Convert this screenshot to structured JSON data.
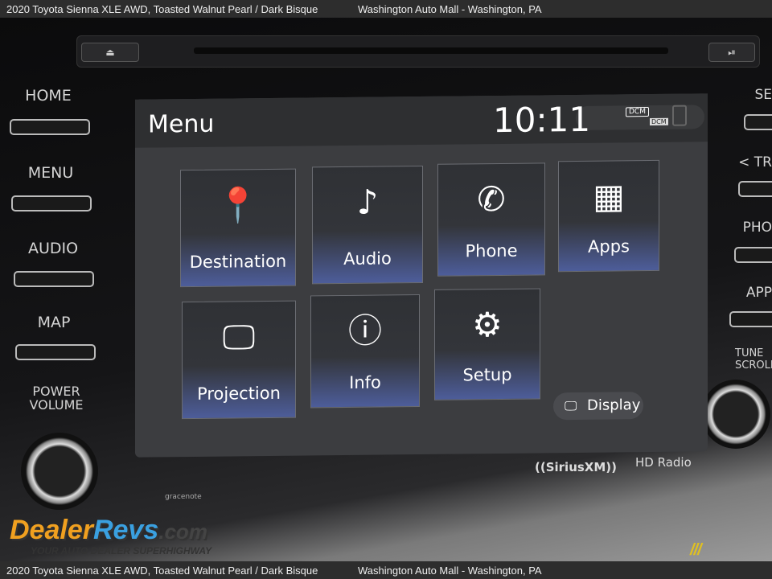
{
  "caption": {
    "vehicle": "2020 Toyota Sienna XLE AWD,  Toasted Walnut Pearl / Dark Bisque",
    "dealer": "Washington Auto Mall - Washington, PA"
  },
  "hardware": {
    "left": [
      "HOME",
      "MENU",
      "AUDIO",
      "MAP"
    ],
    "power": "POWER VOLUME",
    "right": [
      "SE",
      "< TR",
      "PHO",
      "APP"
    ],
    "tune": "TUNE SCROLL",
    "eject": "⏏",
    "play": "⏯"
  },
  "screen": {
    "title": "Menu",
    "clock": "10:11",
    "dcm": "DCM",
    "tiles": [
      {
        "label": "Destination",
        "icon": "📍"
      },
      {
        "label": "Audio",
        "icon": "♪"
      },
      {
        "label": "Phone",
        "icon": "✆"
      },
      {
        "label": "Apps",
        "icon": "▦"
      },
      {
        "label": "Projection",
        "icon": "🖵"
      },
      {
        "label": "Info",
        "icon": "ⓘ"
      },
      {
        "label": "Setup",
        "icon": "⚙"
      }
    ],
    "display": {
      "label": "Display",
      "icon": "🖵"
    }
  },
  "brands": {
    "sirius": "((SiriusXM))",
    "hdradio": "HD Radio",
    "gracenote": "gracenote"
  },
  "watermark": {
    "name1": "Dealer",
    "name2": "Revs",
    "tld": ".com",
    "tagline": "YOUR AUTO DEALER SUPERHIGHWAY",
    "mm": "///"
  }
}
